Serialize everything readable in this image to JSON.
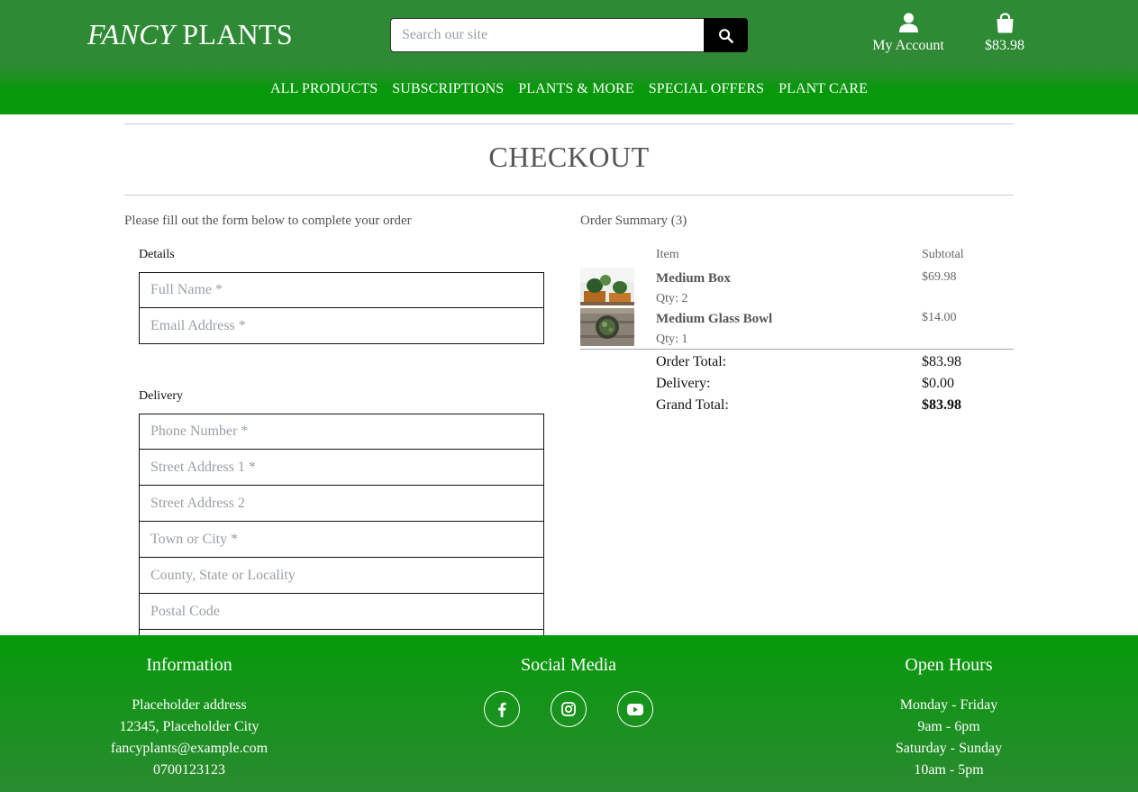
{
  "brand": {
    "part1": "FANCY",
    "part2": "PLANTS"
  },
  "search": {
    "placeholder": "Search our site"
  },
  "header": {
    "account_label": "My Account",
    "cart_total": "$83.98"
  },
  "nav": [
    "ALL PRODUCTS",
    "SUBSCRIPTIONS",
    "PLANTS & MORE",
    "SPECIAL OFFERS",
    "PLANT CARE"
  ],
  "page": {
    "title": "CHECKOUT",
    "intro": "Please fill out the form below to complete your order"
  },
  "form": {
    "details_label": "Details",
    "full_name_placeholder": "Full Name *",
    "email_placeholder": "Email Address *",
    "delivery_label": "Delivery",
    "phone_placeholder": "Phone Number *",
    "street1_placeholder": "Street Address 1 *",
    "street2_placeholder": "Street Address 2",
    "town_placeholder": "Town or City *",
    "county_placeholder": "County, State or Locality",
    "postcode_placeholder": "Postal Code"
  },
  "summary": {
    "title": "Order Summary (3)",
    "col_item": "Item",
    "col_subtotal": "Subtotal",
    "items": [
      {
        "name": "Medium Box",
        "qty": "Qty: 2",
        "subtotal": "$69.98"
      },
      {
        "name": "Medium Glass Bowl",
        "qty": "Qty: 1",
        "subtotal": "$14.00"
      }
    ],
    "order_total_label": "Order Total:",
    "order_total": "$83.98",
    "delivery_label": "Delivery:",
    "delivery": "$0.00",
    "grand_total_label": "Grand Total:",
    "grand_total": "$83.98"
  },
  "footer": {
    "info_title": "Information",
    "info_lines": [
      "Placeholder address",
      "12345, Placeholder City",
      "fancyplants@example.com",
      "0700123123"
    ],
    "social_title": "Social Media",
    "social_icons": [
      "facebook-icon",
      "instagram-icon",
      "youtube-icon"
    ],
    "hours_title": "Open Hours",
    "hours_lines": [
      "Monday - Friday",
      "9am - 6pm",
      "Saturday - Sunday",
      "10am - 5pm"
    ]
  },
  "colors": {
    "header_green": "#2f8a35",
    "nav_green": "#069a0a",
    "button_black": "#000000"
  }
}
